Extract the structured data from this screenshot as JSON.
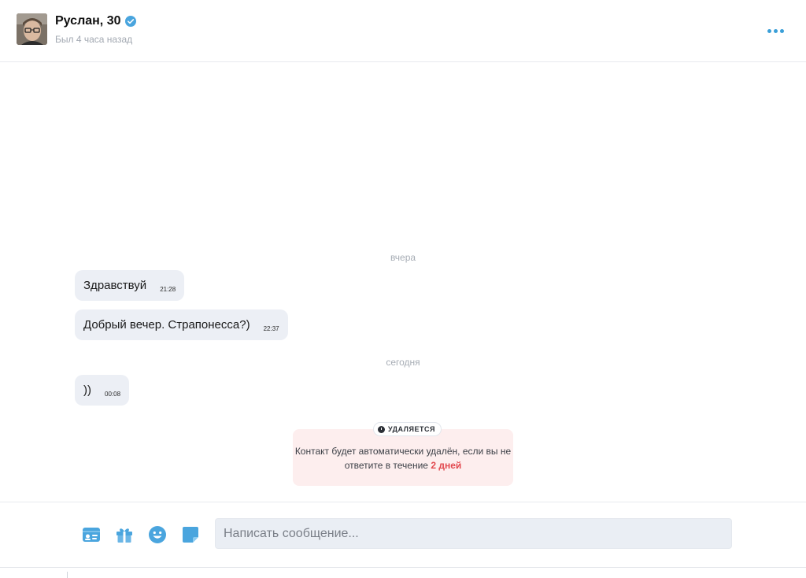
{
  "header": {
    "name": "Руслан, 30",
    "status": "Был 4 часа назад"
  },
  "messages": [
    {
      "date_separator": "вчера"
    },
    {
      "text": "Здравствуй",
      "time": "21:28"
    },
    {
      "text": "Добрый вечер. Страпонесса?)",
      "time": "22:37"
    },
    {
      "date_separator": "сегодня"
    },
    {
      "text": "))",
      "time": "00:08"
    }
  ],
  "notice": {
    "badge": "УДАЛЯЕТСЯ",
    "text_before": "Контакт будет автоматически удалён, если вы не ответите в течение",
    "highlight": "2 дней"
  },
  "composer": {
    "placeholder": "Написать сообщение...",
    "tools": [
      "contact-card-icon",
      "gift-icon",
      "emoji-icon",
      "sticker-icon"
    ]
  },
  "colors": {
    "accent": "#3a9fd8",
    "bubble": "#eceff5",
    "notice_bg": "#fdeeee",
    "warning": "#e2494f"
  }
}
